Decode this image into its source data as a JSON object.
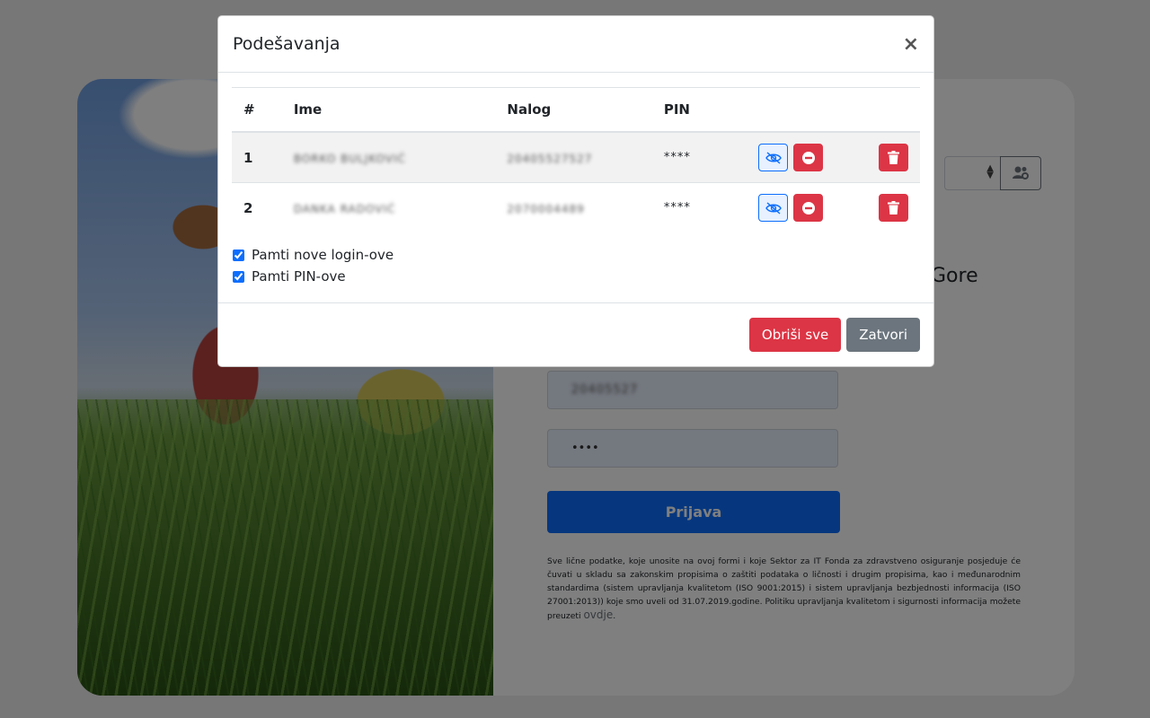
{
  "background": {
    "title_fragment": "Gore",
    "account_value": "20405527",
    "pin_value": "••••",
    "login_button": "Prijava",
    "disclaimer_text": "Sve lične podatke, koje unosite na ovoj formi i koje Sektor za IT Fonda za zdravstveno osiguranje posjeduje će čuvati u skladu sa zakonskim propisima o zaštiti podataka o ličnosti i drugim propisima, kao i međunarodnim standardima (sistem upravljanja kvalitetom (ISO 9001:2015) i sistem upravljanja bezbjednosti informacija (ISO 27001:2013)) koje smo uveli od 31.07.2019.godine. Politiku upravljanja kvalitetom i sigurnosti informacija možete preuzeti",
    "disclaimer_link": "ovdje",
    "disclaimer_end": "."
  },
  "modal": {
    "title": "Podešavanja",
    "close_symbol": "×",
    "table": {
      "headers": {
        "num": "#",
        "name": "Ime",
        "account": "Nalog",
        "pin": "PIN"
      },
      "rows": [
        {
          "num": "1",
          "name": "BORKO BULJKOVIĆ",
          "account": "20405527527",
          "pin": "****"
        },
        {
          "num": "2",
          "name": "DANKA RADOVIĆ",
          "account": "2070004489",
          "pin": "****"
        }
      ]
    },
    "checkboxes": [
      {
        "label": "Pamti nove login-ove",
        "checked": true
      },
      {
        "label": "Pamti PIN-ove",
        "checked": true
      }
    ],
    "footer": {
      "delete_all": "Obriši sve",
      "close": "Zatvori"
    }
  },
  "colors": {
    "primary": "#0d6efd",
    "danger": "#dc3545",
    "secondary": "#6c757d"
  }
}
